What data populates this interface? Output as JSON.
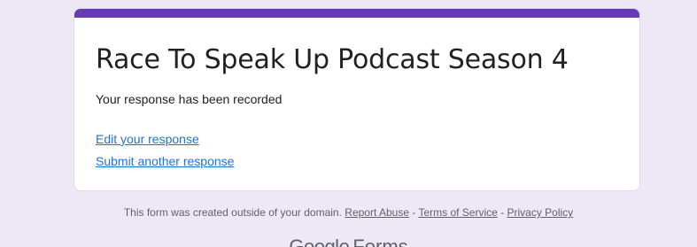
{
  "card": {
    "title": "Race To Speak Up Podcast Season 4",
    "message": "Your response has been recorded",
    "links": {
      "edit": "Edit your response",
      "submit_another": "Submit another response"
    }
  },
  "footer": {
    "notice": "This form was created outside of your domain.",
    "report_abuse": "Report Abuse",
    "sep1": " - ",
    "terms": "Terms of Service",
    "sep2": " - ",
    "privacy": "Privacy Policy"
  },
  "logo": {
    "word1": "Google",
    "word2": "Forms"
  },
  "colors": {
    "accent": "#673ab7",
    "background": "#ede7f6",
    "link": "#1a73e8"
  }
}
